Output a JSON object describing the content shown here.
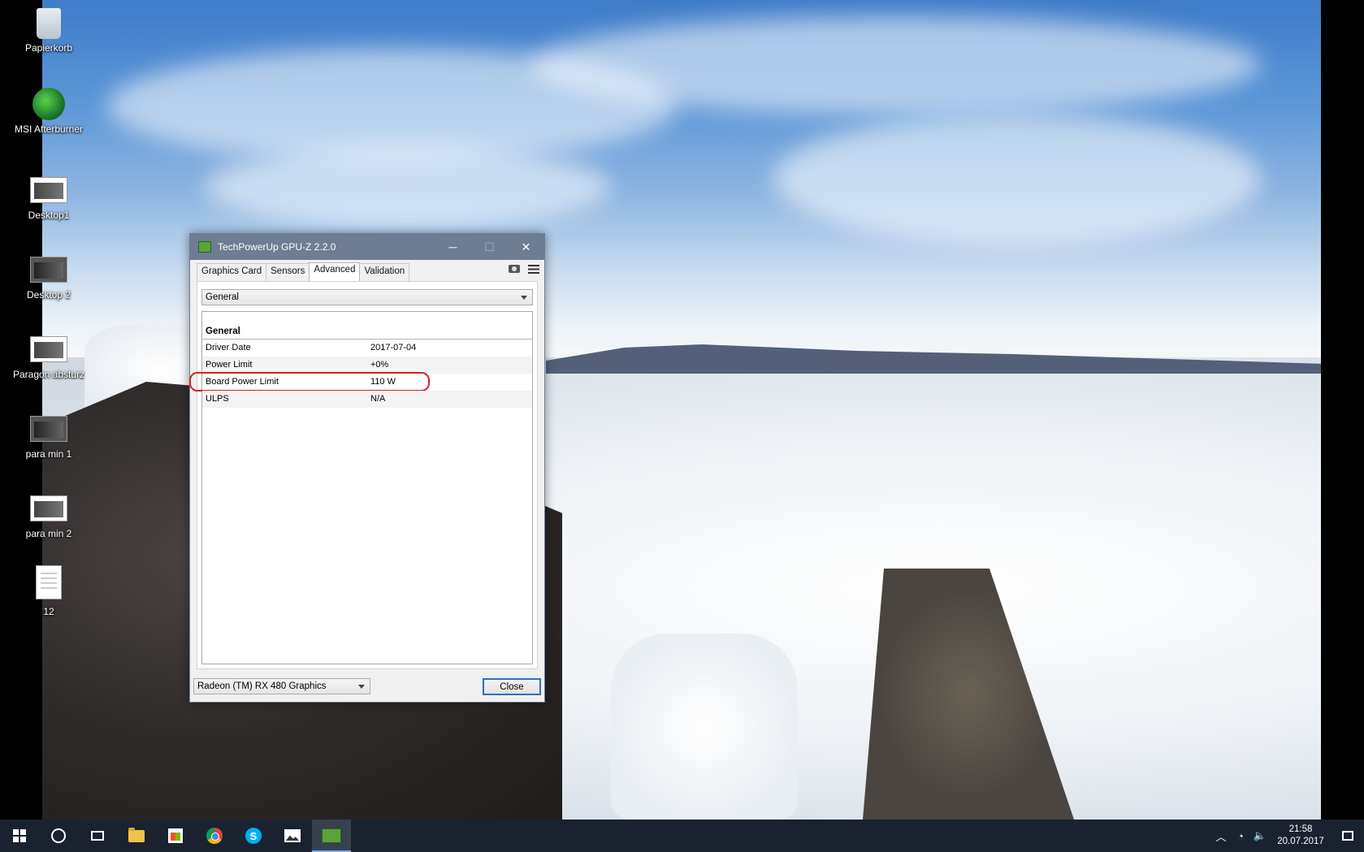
{
  "desktop": {
    "icons": [
      {
        "label": "Papierkorb",
        "icon": "recycle-bin-icon"
      },
      {
        "label": "MSI Afterburner",
        "icon": "msi-afterburner-icon"
      },
      {
        "label": "Desktop1",
        "icon": "screenshot-file-icon"
      },
      {
        "label": "Desktop 2",
        "icon": "screenshot-file-icon"
      },
      {
        "label": "Paragon absturz",
        "icon": "screenshot-file-icon"
      },
      {
        "label": "para min 1",
        "icon": "screenshot-file-icon"
      },
      {
        "label": "para min 2",
        "icon": "screenshot-file-icon"
      },
      {
        "label": "12",
        "icon": "text-document-icon"
      }
    ]
  },
  "window": {
    "title": "TechPowerUp GPU-Z 2.2.0",
    "controls": {
      "minimize": "─",
      "maximize": "☐",
      "close": "✕"
    },
    "tabs": [
      {
        "label": "Graphics Card",
        "active": false
      },
      {
        "label": "Sensors",
        "active": false
      },
      {
        "label": "Advanced",
        "active": true
      },
      {
        "label": "Validation",
        "active": false
      }
    ],
    "category_select": {
      "value": "General"
    },
    "section": "General",
    "rows": [
      {
        "key": "Driver Date",
        "value": "2017-07-04"
      },
      {
        "key": "Power Limit",
        "value": "+0%"
      },
      {
        "key": "Board Power Limit",
        "value": "110 W",
        "highlighted": true
      },
      {
        "key": "ULPS",
        "value": "N/A"
      }
    ],
    "gpu_select": {
      "value": "Radeon (TM) RX 480 Graphics"
    },
    "close_label": "Close"
  },
  "taskbar": {
    "apps": [
      "start-icon",
      "cortana-icon",
      "task-view-icon",
      "file-explorer-icon",
      "store-icon",
      "chrome-icon",
      "skype-icon",
      "photos-icon",
      "gpuz-icon"
    ],
    "active_app": "gpuz-icon",
    "clock": {
      "time": "21:58",
      "date": "20.07.2017"
    }
  },
  "colors": {
    "titlebar": "#6e7d92",
    "highlight_circle": "#d6212a",
    "taskbar": "#1a2230"
  }
}
